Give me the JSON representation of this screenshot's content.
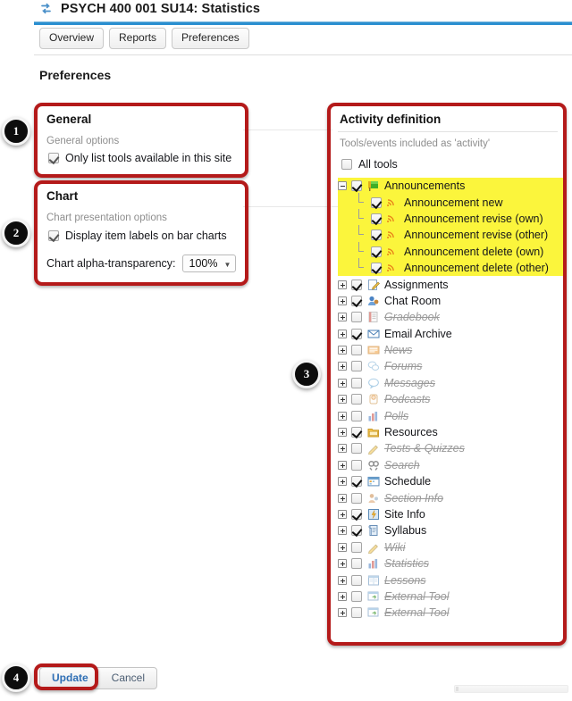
{
  "header": {
    "icon": "statistics-icon",
    "title": "PSYCH 400 001 SU14: Statistics",
    "tabs": [
      {
        "label": "Overview"
      },
      {
        "label": "Reports"
      },
      {
        "label": "Preferences"
      }
    ]
  },
  "page": {
    "title": "Preferences"
  },
  "general": {
    "heading": "General",
    "subheading": "General options",
    "only_list_tools": {
      "label": "Only list tools available in this site",
      "checked": true
    }
  },
  "chart": {
    "heading": "Chart",
    "subheading": "Chart presentation options",
    "display_item_labels": {
      "label": "Display item labels on bar charts",
      "checked": true
    },
    "alpha": {
      "caption": "Chart alpha-transparency:",
      "value": "100%",
      "caret": "chevron-down-icon"
    }
  },
  "activity": {
    "heading": "Activity definition",
    "subheading": "Tools/events included as 'activity'",
    "all_tools": {
      "label": "All tools",
      "checked": false
    },
    "tree": [
      {
        "label": "Announcements",
        "checked": true,
        "enabled": true,
        "expander": "minus",
        "icon": "announcements-icon",
        "highlight": true,
        "level": 0
      },
      {
        "label": "Announcement new",
        "checked": true,
        "enabled": true,
        "expander": "none",
        "icon": "rss-icon",
        "highlight": true,
        "level": 1
      },
      {
        "label": "Announcement revise (own)",
        "checked": true,
        "enabled": true,
        "expander": "none",
        "icon": "rss-icon",
        "highlight": true,
        "level": 1
      },
      {
        "label": "Announcement revise (other)",
        "checked": true,
        "enabled": true,
        "expander": "none",
        "icon": "rss-icon",
        "highlight": true,
        "level": 1
      },
      {
        "label": "Announcement delete (own)",
        "checked": true,
        "enabled": true,
        "expander": "none",
        "icon": "rss-icon",
        "highlight": true,
        "level": 1
      },
      {
        "label": "Announcement delete (other)",
        "checked": true,
        "enabled": true,
        "expander": "none",
        "icon": "rss-icon",
        "highlight": true,
        "level": 1
      },
      {
        "label": "Assignments",
        "checked": true,
        "enabled": true,
        "expander": "plus",
        "icon": "assignments-icon",
        "highlight": false,
        "level": 0
      },
      {
        "label": "Chat Room",
        "checked": true,
        "enabled": true,
        "expander": "plus",
        "icon": "chat-icon",
        "highlight": false,
        "level": 0
      },
      {
        "label": "Gradebook",
        "checked": false,
        "enabled": false,
        "expander": "plus",
        "icon": "gradebook-icon",
        "highlight": false,
        "level": 0
      },
      {
        "label": "Email Archive",
        "checked": true,
        "enabled": true,
        "expander": "plus",
        "icon": "email-icon",
        "highlight": false,
        "level": 0
      },
      {
        "label": "News",
        "checked": false,
        "enabled": false,
        "expander": "plus",
        "icon": "news-icon",
        "highlight": false,
        "level": 0
      },
      {
        "label": "Forums",
        "checked": false,
        "enabled": false,
        "expander": "plus",
        "icon": "forums-icon",
        "highlight": false,
        "level": 0
      },
      {
        "label": "Messages",
        "checked": false,
        "enabled": false,
        "expander": "plus",
        "icon": "messages-icon",
        "highlight": false,
        "level": 0
      },
      {
        "label": "Podcasts",
        "checked": false,
        "enabled": false,
        "expander": "plus",
        "icon": "podcasts-icon",
        "highlight": false,
        "level": 0
      },
      {
        "label": "Polls",
        "checked": false,
        "enabled": false,
        "expander": "plus",
        "icon": "polls-icon",
        "highlight": false,
        "level": 0
      },
      {
        "label": "Resources",
        "checked": true,
        "enabled": true,
        "expander": "plus",
        "icon": "resources-icon",
        "highlight": false,
        "level": 0
      },
      {
        "label": "Tests & Quizzes",
        "checked": false,
        "enabled": false,
        "expander": "plus",
        "icon": "tests-icon",
        "highlight": false,
        "level": 0
      },
      {
        "label": "Search",
        "checked": false,
        "enabled": false,
        "expander": "plus",
        "icon": "search-icon",
        "highlight": false,
        "level": 0
      },
      {
        "label": "Schedule",
        "checked": true,
        "enabled": true,
        "expander": "plus",
        "icon": "schedule-icon",
        "highlight": false,
        "level": 0
      },
      {
        "label": "Section Info",
        "checked": false,
        "enabled": false,
        "expander": "plus",
        "icon": "section-info-icon",
        "highlight": false,
        "level": 0
      },
      {
        "label": "Site Info",
        "checked": true,
        "enabled": true,
        "expander": "plus",
        "icon": "site-info-icon",
        "highlight": false,
        "level": 0
      },
      {
        "label": "Syllabus",
        "checked": true,
        "enabled": true,
        "expander": "plus",
        "icon": "syllabus-icon",
        "highlight": false,
        "level": 0
      },
      {
        "label": "Wiki",
        "checked": false,
        "enabled": false,
        "expander": "plus",
        "icon": "wiki-icon",
        "highlight": false,
        "level": 0
      },
      {
        "label": "Statistics",
        "checked": false,
        "enabled": false,
        "expander": "plus",
        "icon": "statistics-icon",
        "highlight": false,
        "level": 0
      },
      {
        "label": "Lessons",
        "checked": false,
        "enabled": false,
        "expander": "plus",
        "icon": "lessons-icon",
        "highlight": false,
        "level": 0
      },
      {
        "label": "External Tool",
        "checked": false,
        "enabled": false,
        "expander": "plus",
        "icon": "external-tool-icon",
        "highlight": false,
        "level": 0
      },
      {
        "label": "External Tool",
        "checked": false,
        "enabled": false,
        "expander": "plus",
        "icon": "external-tool-icon",
        "highlight": false,
        "level": 0
      }
    ]
  },
  "footer": {
    "update_label": "Update",
    "cancel_label": "Cancel"
  },
  "callouts": [
    {
      "number": "1"
    },
    {
      "number": "2"
    },
    {
      "number": "3"
    },
    {
      "number": "4"
    }
  ],
  "colors": {
    "highlight_yellow": "#fbf53c",
    "callout_red": "#b41a1a",
    "header_blue": "#2a8fd0",
    "link_blue": "#2f6fb5"
  }
}
